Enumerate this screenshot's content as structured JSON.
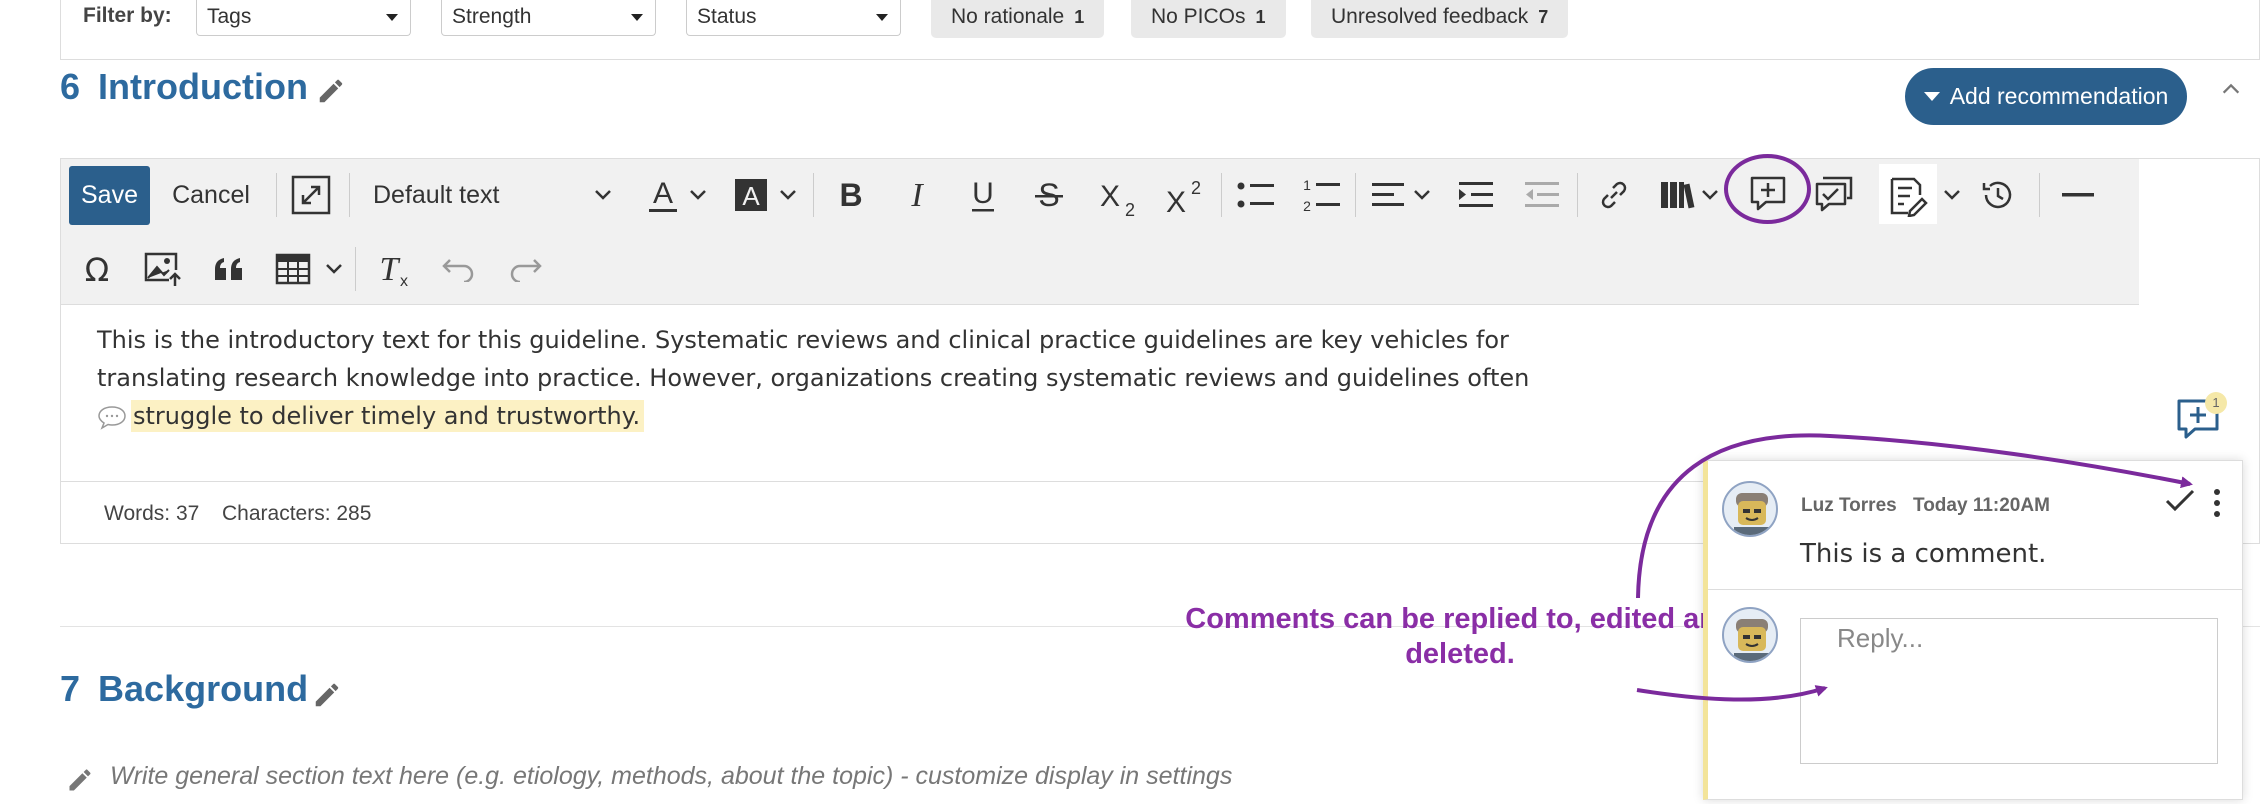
{
  "filter_bar": {
    "label": "Filter by:",
    "selects": [
      {
        "value": "Tags"
      },
      {
        "value": "Strength"
      },
      {
        "value": "Status"
      }
    ],
    "chips": [
      {
        "label": "No rationale",
        "count": "1"
      },
      {
        "label": "No PICOs",
        "count": "1"
      },
      {
        "label": "Unresolved feedback",
        "count": "7"
      }
    ]
  },
  "sections": [
    {
      "number": "6",
      "title": "Introduction"
    },
    {
      "number": "7",
      "title": "Background"
    }
  ],
  "add_recommendation_label": "Add recommendation",
  "editor": {
    "save_label": "Save",
    "cancel_label": "Cancel",
    "font_style": "Default text",
    "content_line1": "This is the introductory text for this guideline. Systematic reviews and clinical practice guidelines are key vehicles for",
    "content_line2": "translating research knowledge into practice. However, organizations creating systematic reviews and guidelines often",
    "content_highlighted": "struggle to deliver timely and trustworthy.",
    "words": "Words: 37",
    "characters": "Characters: 285"
  },
  "comment_badge": "1",
  "comment": {
    "author": "Luz Torres",
    "time": "Today 11:20AM",
    "text": "This is a comment.",
    "reply_placeholder": "Reply..."
  },
  "annotation_text": "Comments can be replied to, edited and deleted.",
  "background_placeholder": "Write general section text here (e.g. etiology, methods, about the topic) - customize display in settings",
  "colors": {
    "primary": "#2b5f8c",
    "heading": "#2d6a9f",
    "annotation": "#8a2ea6",
    "highlight": "#fcf1c4"
  }
}
